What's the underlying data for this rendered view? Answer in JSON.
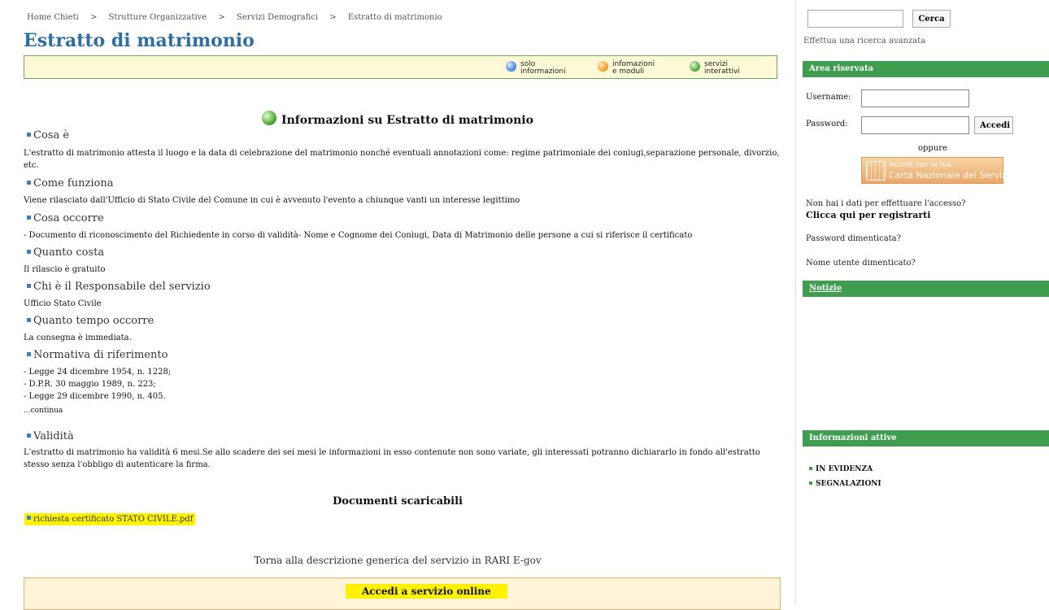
{
  "breadcrumb": [
    "Home Chieti",
    ">",
    "Strutture Organizzative",
    ">",
    "Servizi Demografici",
    ">",
    "Estratto di matrimonio"
  ],
  "page_title": "Estratto di matrimonio",
  "legend": [
    {
      "line1": "solo",
      "line2": "informazioni",
      "color": "blue"
    },
    {
      "line1": "infomazioni",
      "line2": "e moduli",
      "color": "orange"
    },
    {
      "line1": "servizi",
      "line2": "interattivi",
      "color": "green"
    }
  ],
  "info_heading": "Informazioni su Estratto di matrimonio",
  "sections": {
    "cosa_e": {
      "label": "Cosa è",
      "text": "L'estratto di matrimonio attesta il luogo e la data di celebrazione del matrimonio nonché eventuali annotazioni come: regime patrimoniale dei coniugi,separazione personale, divorzio, etc."
    },
    "come_funziona": {
      "label": "Come funziona",
      "text": "Viene rilasciato dall'Ufficio di Stato Civile del Comune in cui è avvenuto l'evento a chiunque vanti un interesse legittimo"
    },
    "cosa_occorre": {
      "label": "Cosa occorre",
      "text": "- Documento di riconoscimento del Richiedente in corso di validità- Nome e Cognome dei Coniugi, Data di Matrimonio delle persone a cui si riferisce il certificato"
    },
    "quanto_costa": {
      "label": "Quanto costa",
      "text": "Il rilascio è gratuito"
    },
    "responsabile": {
      "label": "Chi è il Responsabile del servizio",
      "text": "Ufficio Stato Civile"
    },
    "tempo": {
      "label": "Quanto tempo occorre",
      "text": "La consegna è immediata."
    },
    "normativa": {
      "label": "Normativa di riferimento",
      "lines": [
        "- Legge 24 dicembre 1954, n. 1228;",
        "- D.P.R. 30 maggio 1989, n. 223;",
        "- Legge 29 dicembre 1990, n. 405."
      ],
      "more": "...continua"
    },
    "validita": {
      "label": "Validità",
      "text": "L'estratto di matrimonio ha validità 6 mesi.Se allo scadere dei sei mesi le informazioni in esso contenute non sono variate, gli interessati potranno dichiararlo in fondo all'estratto stesso senza l'obbligo di autenticare la firma."
    }
  },
  "downloads": {
    "heading": "Documenti scaricabili",
    "file": "richiesta certificato STATO CIVILE.pdf"
  },
  "back_link": "Torna alla descrizione generica del servizio in RARI E-gov",
  "online_button": "Accedi a servizio online",
  "sidebar": {
    "search_button": "Cerca",
    "advanced_search": "Effettua una ricerca avanzata",
    "area_riservata": "Area riservata",
    "username_label": "Username:",
    "password_label": "Password:",
    "login_button": "Accedi",
    "oppure": "oppure",
    "cns_line1": "Accedi con la tua",
    "cns_line2": "Carta Nazionale dei Servizi",
    "no_data": "Non hai i dati per effettuare l'accesso?",
    "register": "Clicca qui per registrarti",
    "forgot_password": "Password dimenticata?",
    "forgot_username": "Nome utente dimenticato?",
    "notizie": "Notizie",
    "info_attive": "Informazioni attive",
    "info_items": [
      "IN EVIDENZA",
      "SEGNALAZIONI"
    ]
  }
}
